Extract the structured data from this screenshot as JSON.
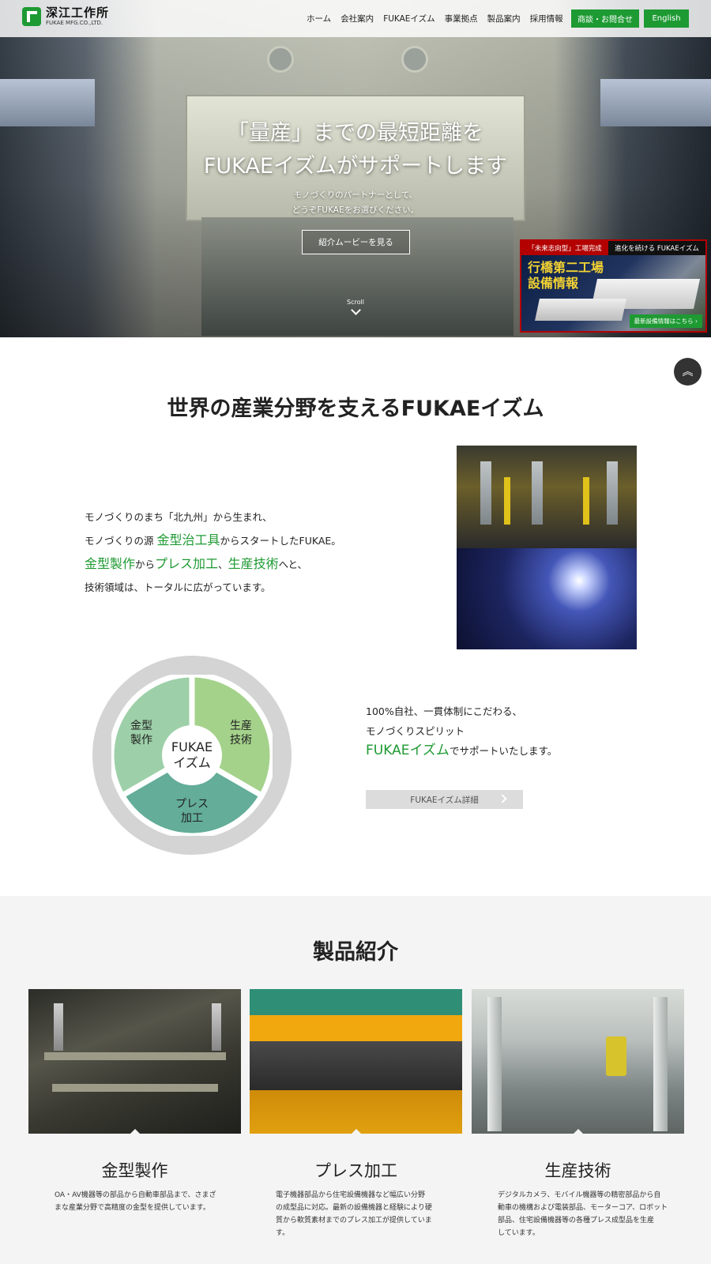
{
  "header": {
    "logo_jp": "深江工作所",
    "logo_en": "FUKAE MFG.CO.,LTD.",
    "nav": [
      "ホーム",
      "会社案内",
      "FUKAEイズム",
      "事業拠点",
      "製品案内",
      "採用情報"
    ],
    "contact_label": "商談・お問合せ",
    "english_label": "English",
    "accent_color": "#1e9a33"
  },
  "hero": {
    "title_line1": "「量産」までの最短距離を",
    "title_line2": "FUKAEイズムがサポートします",
    "sub_line1": "モノづくりのパートナーとして、",
    "sub_line2": "どうぞFUKAEをお選びください。",
    "video_button": "紹介ムービーを見る",
    "scroll_label": "Scroll"
  },
  "banner": {
    "tag_left": "「未来志向型」工場完成",
    "tag_right": "進化を続ける FUKAEイズム",
    "title_line1": "行橋第二工場",
    "title_line2": "設備情報",
    "button": "最新設備情報はこちら ›"
  },
  "page_top_icon": "double-chevron-up-icon",
  "philosophy": {
    "title": "世界の産業分野を支えるFUKAEイズム",
    "line1": "モノづくりのまち「北九州」から生まれ、",
    "line2_a": "モノづくりの源 ",
    "line2_g": "金型治工具",
    "line2_b": "からスタートしたFUKAE。",
    "line3_g1": "金型製作",
    "line3_a": "から",
    "line3_g2": "プレス加工",
    "line3_b": "、",
    "line3_g3": "生産技術",
    "line3_c": "へと、",
    "line4": "技術領域は、トータルに広がっています。"
  },
  "circle": {
    "center_1": "FUKAE",
    "center_2": "イズム",
    "seg_left_1": "金型",
    "seg_left_2": "製作",
    "seg_right_1": "生産",
    "seg_right_2": "技術",
    "seg_bottom_1": "プレス",
    "seg_bottom_2": "加工",
    "colors": {
      "left": "#9dd0a8",
      "right": "#a4d28b",
      "bottom": "#63ad99",
      "ring": "#d4d4d4"
    }
  },
  "spirit": {
    "line1": "100%自社、一貫体制にこだわる、",
    "line2": "モノづくりスピリット",
    "line3_g": "FUKAEイズム",
    "line3_b": "でサポートいたします。",
    "button": "FUKAEイズム詳細"
  },
  "products": {
    "title": "製品紹介",
    "items": [
      {
        "title": "金型製作",
        "desc_1": "OA・AV機器等の部品から自動車部品まで、さまざ",
        "desc_2": "まな産業分野で高精度の金型を提供しています。",
        "desc_3": "",
        "desc_4": ""
      },
      {
        "title": "プレス加工",
        "desc_1": "電子機器部品から住宅設備機器など幅広い分野",
        "desc_2": "の成型品に対応。最新の設備機器と経験により硬",
        "desc_3": "質から軟質素材までのプレス加工が提供していま",
        "desc_4": "す。"
      },
      {
        "title": "生産技術",
        "desc_1": "デジタルカメラ、モバイル機器等の精密部品から自",
        "desc_2": "動車の機構および電装部品、モーターコア、ロボット",
        "desc_3": "部品、住宅設備機器等の各種プレス成型品を生産",
        "desc_4": "しています。"
      }
    ]
  }
}
